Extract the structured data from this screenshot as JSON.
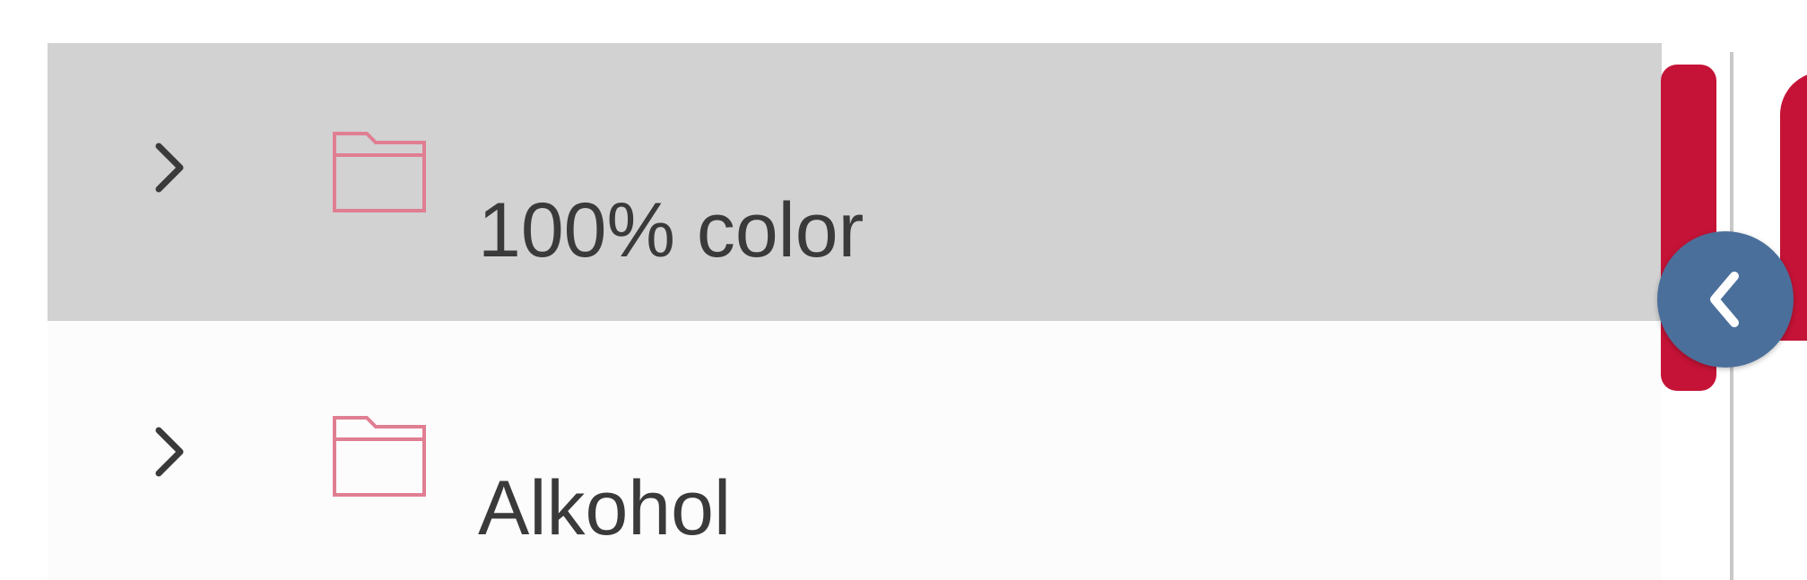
{
  "tree": {
    "items": [
      {
        "label": "100% color",
        "selected": true,
        "expanded": false,
        "icon": "folder-icon",
        "chevron_icon": "chevron-right-icon"
      },
      {
        "label": "Alkohol",
        "selected": false,
        "expanded": false,
        "icon": "folder-icon",
        "chevron_icon": "chevron-right-icon"
      }
    ]
  },
  "panel": {
    "collapse_icon": "chevron-left-icon"
  },
  "colors": {
    "accent_red": "#c41336",
    "folder_pink": "#e07e92",
    "selected_row": "#d2d2d2",
    "collapse_button": "#4b6f9b"
  }
}
